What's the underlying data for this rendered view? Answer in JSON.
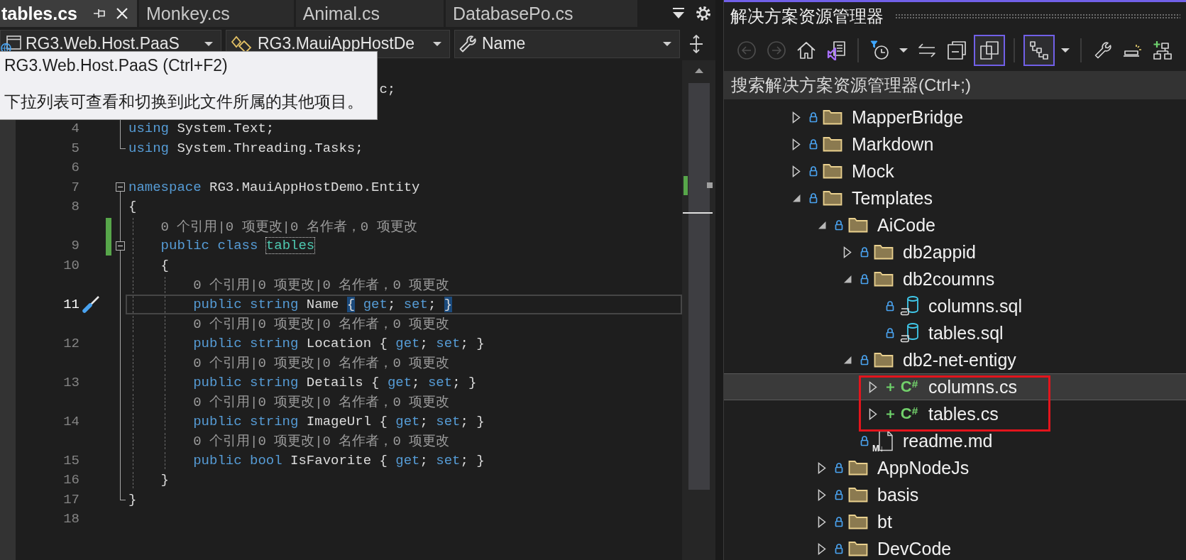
{
  "editor": {
    "tabs": [
      {
        "label": "tables.cs",
        "selected": true
      },
      {
        "label": "Monkey.cs",
        "selected": false
      },
      {
        "label": "Animal.cs",
        "selected": false
      },
      {
        "label": "DatabasePo.cs",
        "selected": false
      }
    ],
    "navigation": [
      {
        "kind": "project",
        "value": "RG3.Web.Host.PaaS"
      },
      {
        "kind": "type",
        "value": "RG3.MauiAppHostDe"
      },
      {
        "kind": "member",
        "value": "Name"
      }
    ],
    "tooltip": {
      "title": "RG3.Web.Host.PaaS (Ctrl+F2)",
      "description": "下拉列表可查看和切换到此文件所属的其他项目。"
    },
    "covered_fragment": "c;",
    "lines": [
      {
        "number": "4",
        "kind": "inside",
        "current": false,
        "changed": false,
        "tokens": [
          {
            "kind": "keyword",
            "text": "using "
          },
          {
            "kind": "plain",
            "text": "System.Text;"
          }
        ]
      },
      {
        "number": "5",
        "kind": "end",
        "current": false,
        "changed": false,
        "tokens": [
          {
            "kind": "keyword",
            "text": "using "
          },
          {
            "kind": "plain",
            "text": "System.Threading.Tasks;"
          }
        ]
      },
      {
        "number": "6",
        "kind": "plain",
        "current": false,
        "changed": false
      },
      {
        "number": "7",
        "kind": "start",
        "expanded": true,
        "current": false,
        "changed": false,
        "tokens": [
          {
            "kind": "keyword",
            "text": "namespace "
          },
          {
            "kind": "plain",
            "text": "RG3.MauiAppHostDemo.Entity"
          }
        ]
      },
      {
        "number": "8",
        "kind": "inside",
        "current": false,
        "changed": false,
        "tokens": [
          {
            "kind": "plain",
            "text": "{"
          }
        ]
      },
      {
        "number": "9",
        "codelens": "0 个引用|0 项更改|0 名作者，0 项更改",
        "kind": "start",
        "expanded": true,
        "current": false,
        "changed": true,
        "tokens": [
          {
            "kind": "keyword",
            "text": "    public class "
          },
          {
            "kind": "classname",
            "text": "tables"
          }
        ]
      },
      {
        "number": "10",
        "kind": "inside",
        "current": false,
        "changed": false,
        "tokens": [
          {
            "kind": "plain",
            "text": "    {"
          }
        ]
      },
      {
        "number": "11",
        "codelens": "0 个引用|0 项更改|0 名作者，0 项更改",
        "kind": "inside",
        "current": true,
        "changed": false,
        "tokens": [
          {
            "kind": "keyword",
            "text": "        public string "
          },
          {
            "kind": "plain",
            "text": "Name "
          },
          {
            "kind": "brace_match",
            "text": "{"
          },
          {
            "kind": "keyword",
            "text": " get"
          },
          {
            "kind": "plain",
            "text": "; "
          },
          {
            "kind": "keyword",
            "text": "set"
          },
          {
            "kind": "plain",
            "text": "; "
          },
          {
            "kind": "brace_match",
            "text": "}"
          }
        ]
      },
      {
        "number": "12",
        "codelens": "0 个引用|0 项更改|0 名作者，0 项更改",
        "kind": "inside",
        "current": false,
        "changed": false,
        "tokens": [
          {
            "kind": "keyword",
            "text": "        public string "
          },
          {
            "kind": "plain",
            "text": "Location { "
          },
          {
            "kind": "keyword",
            "text": "get"
          },
          {
            "kind": "plain",
            "text": "; "
          },
          {
            "kind": "keyword",
            "text": "set"
          },
          {
            "kind": "plain",
            "text": "; }"
          }
        ]
      },
      {
        "number": "13",
        "codelens": "0 个引用|0 项更改|0 名作者，0 项更改",
        "kind": "inside",
        "current": false,
        "changed": false,
        "tokens": [
          {
            "kind": "keyword",
            "text": "        public string "
          },
          {
            "kind": "plain",
            "text": "Details { "
          },
          {
            "kind": "keyword",
            "text": "get"
          },
          {
            "kind": "plain",
            "text": "; "
          },
          {
            "kind": "keyword",
            "text": "set"
          },
          {
            "kind": "plain",
            "text": "; }"
          }
        ]
      },
      {
        "number": "14",
        "codelens": "0 个引用|0 项更改|0 名作者，0 项更改",
        "kind": "inside",
        "current": false,
        "changed": false,
        "tokens": [
          {
            "kind": "keyword",
            "text": "        public string "
          },
          {
            "kind": "plain",
            "text": "ImageUrl { "
          },
          {
            "kind": "keyword",
            "text": "get"
          },
          {
            "kind": "plain",
            "text": "; "
          },
          {
            "kind": "keyword",
            "text": "set"
          },
          {
            "kind": "plain",
            "text": "; }"
          }
        ]
      },
      {
        "number": "15",
        "codelens": "0 个引用|0 项更改|0 名作者，0 项更改",
        "kind": "inside",
        "current": false,
        "changed": false,
        "tokens": [
          {
            "kind": "keyword",
            "text": "        public bool "
          },
          {
            "kind": "plain",
            "text": "IsFavorite { "
          },
          {
            "kind": "keyword",
            "text": "get"
          },
          {
            "kind": "plain",
            "text": "; "
          },
          {
            "kind": "keyword",
            "text": "set"
          },
          {
            "kind": "plain",
            "text": "; }"
          }
        ]
      },
      {
        "number": "16",
        "kind": "inside",
        "current": false,
        "changed": false,
        "tokens": [
          {
            "kind": "plain",
            "text": "    }"
          }
        ]
      },
      {
        "number": "17",
        "kind": "end",
        "current": false,
        "changed": false,
        "tokens": [
          {
            "kind": "plain",
            "text": "}"
          }
        ]
      },
      {
        "number": "18",
        "kind": "plain",
        "current": false,
        "changed": false
      }
    ]
  },
  "solution_explorer": {
    "title": "解决方案资源管理器",
    "toolbar": [
      {
        "kind": "back",
        "disabled": true,
        "on": false
      },
      {
        "kind": "forward",
        "disabled": true,
        "on": false
      },
      {
        "kind": "home",
        "disabled": false,
        "on": false
      },
      {
        "kind": "solution",
        "disabled": false,
        "on": false
      },
      {
        "kind": "separator"
      },
      {
        "kind": "pending",
        "disabled": false,
        "on": false
      },
      {
        "kind": "caret",
        "disabled": false,
        "on": false
      },
      {
        "kind": "sync",
        "disabled": false,
        "on": false
      },
      {
        "kind": "collapse",
        "disabled": false,
        "on": false
      },
      {
        "kind": "showall",
        "disabled": false,
        "on": true
      },
      {
        "kind": "separator"
      },
      {
        "kind": "view",
        "disabled": false,
        "on": true
      },
      {
        "kind": "caret",
        "disabled": false,
        "on": false
      },
      {
        "kind": "separator"
      },
      {
        "kind": "properties",
        "disabled": false,
        "on": false
      },
      {
        "kind": "preview",
        "disabled": false,
        "on": false
      },
      {
        "kind": "newfolder",
        "disabled": false,
        "on": false
      }
    ],
    "search": {
      "placeholder": "搜索解决方案资源管理器(Ctrl+;)"
    },
    "tree": [
      {
        "label": "MapperBridge",
        "kind": "folder",
        "locked": true,
        "added": false,
        "expanded": false,
        "selected": false,
        "annotated": false
      },
      {
        "label": "Markdown",
        "kind": "folder",
        "locked": true,
        "added": false,
        "expanded": false,
        "selected": false,
        "annotated": false
      },
      {
        "label": "Mock",
        "kind": "folder",
        "locked": true,
        "added": false,
        "expanded": false,
        "selected": false,
        "annotated": false
      },
      {
        "label": "Templates",
        "kind": "folder",
        "locked": true,
        "added": false,
        "expanded": true,
        "selected": false,
        "annotated": false,
        "children": [
          {
            "label": "AiCode",
            "kind": "folder",
            "locked": true,
            "added": false,
            "expanded": true,
            "selected": false,
            "annotated": false,
            "children": [
              {
                "label": "db2appid",
                "kind": "folder",
                "locked": true,
                "added": false,
                "expanded": false,
                "selected": false,
                "annotated": false
              },
              {
                "label": "db2coumns",
                "kind": "folder",
                "locked": true,
                "added": false,
                "expanded": true,
                "selected": false,
                "annotated": false,
                "children": [
                  {
                    "label": "columns.sql",
                    "kind": "sql",
                    "locked": true,
                    "added": false,
                    "selected": false,
                    "annotated": false
                  },
                  {
                    "label": "tables.sql",
                    "kind": "sql",
                    "locked": true,
                    "added": false,
                    "selected": false,
                    "annotated": false
                  }
                ]
              },
              {
                "label": "db2-net-entigy",
                "kind": "folder",
                "locked": true,
                "added": false,
                "expanded": true,
                "selected": false,
                "annotated": false,
                "children": [
                  {
                    "label": "columns.cs",
                    "kind": "csharp",
                    "icon_label": "C$^{#}$",
                    "locked": false,
                    "added": true,
                    "expanded": false,
                    "selected": true,
                    "annotated": true
                  },
                  {
                    "label": "tables.cs",
                    "kind": "csharp",
                    "icon_label": "C$^{#}$",
                    "locked": false,
                    "added": true,
                    "expanded": false,
                    "selected": false,
                    "annotated": true
                  }
                ]
              },
              {
                "label": "readme.md",
                "kind": "markdown",
                "icon_label": "M↓",
                "locked": true,
                "added": false,
                "selected": false,
                "annotated": false
              }
            ]
          },
          {
            "label": "AppNodeJs",
            "kind": "folder",
            "locked": true,
            "added": false,
            "expanded": false,
            "selected": false,
            "annotated": false
          },
          {
            "label": "basis",
            "kind": "folder",
            "locked": true,
            "added": false,
            "expanded": false,
            "selected": false,
            "annotated": false
          },
          {
            "label": "bt",
            "kind": "folder",
            "locked": true,
            "added": false,
            "expanded": false,
            "selected": false,
            "annotated": false
          },
          {
            "label": "DevCode",
            "kind": "folder",
            "locked": true,
            "added": false,
            "expanded": false,
            "selected": false,
            "annotated": false
          }
        ]
      }
    ]
  }
}
